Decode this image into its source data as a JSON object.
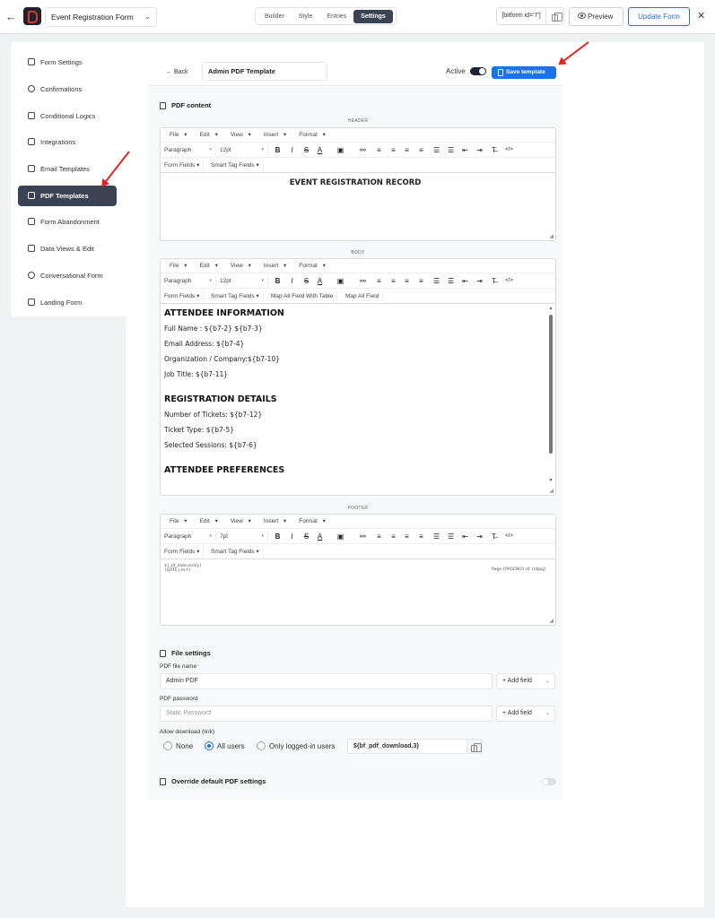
{
  "topbar": {
    "form_name": "Event Registration Form",
    "tabs": [
      {
        "label": "Builder",
        "active": false
      },
      {
        "label": "Style",
        "active": false
      },
      {
        "label": "Entries",
        "active": false
      },
      {
        "label": "Settings",
        "active": true
      }
    ],
    "shortcode": "[bitform id='7']",
    "preview_label": "Preview",
    "update_label": "Update Form",
    "close_glyph": "✕",
    "back_glyph": "←"
  },
  "sidebar": {
    "items": [
      {
        "label": "Form Settings",
        "icon": "sliders-icon",
        "active": false
      },
      {
        "label": "Confirmations",
        "icon": "info-icon",
        "active": false
      },
      {
        "label": "Conditional Logics",
        "icon": "logic-icon",
        "active": false
      },
      {
        "label": "Integrations",
        "icon": "code-icon",
        "active": false
      },
      {
        "label": "Email Templates",
        "icon": "mail-icon",
        "active": false
      },
      {
        "label": "PDF Templates",
        "icon": "document-icon",
        "active": true
      },
      {
        "label": "Form Abandonment",
        "icon": "edit-icon",
        "active": false
      },
      {
        "label": "Data Views & Edit",
        "icon": "table-icon",
        "active": false
      },
      {
        "label": "Conversational Form",
        "icon": "chat-icon",
        "active": false
      },
      {
        "label": "Landing Form",
        "icon": "page-icon",
        "active": false
      }
    ]
  },
  "template": {
    "back_label": "Back",
    "title": "Admin PDF Template",
    "active_label": "Active",
    "save_label": "Save template",
    "pdf_content_label": "PDF content"
  },
  "editor": {
    "menus": [
      "File",
      "Edit",
      "View",
      "Insert",
      "Format"
    ],
    "block_format": "Paragraph",
    "field_buttons": [
      "Form Fields",
      "Smart Tag Fields"
    ],
    "body_extra_buttons": [
      "Map All Field With Table",
      "Map All Field"
    ]
  },
  "header": {
    "caption": "HEADER",
    "font_size": "12pt",
    "content": "EVENT REGISTRATION RECORD"
  },
  "body": {
    "caption": "BODY",
    "font_size": "12pt",
    "sections": [
      {
        "heading": "ATTENDEE INFORMATION",
        "lines": [
          "Full Name : ${b7-2} ${b7-3}",
          "Email Address: ${b7-4}",
          "Organization / Company:${b7-10}",
          "Job Title: ${b7-11}"
        ]
      },
      {
        "heading": "REGISTRATION DETAILS",
        "lines": [
          "Number of Tickets: ${b7-12}",
          "Ticket Type: ${b7-5}",
          "Selected Sessions: ${b7-6}"
        ]
      },
      {
        "heading": "ATTENDEE PREFERENCES",
        "lines": []
      }
    ]
  },
  "footer": {
    "caption": "FOOTER",
    "font_size": "7pt",
    "left_line1": "${_bf_date.m/d/y}",
    "left_line2": "{DATE j-m-Y}",
    "right": "Page {PAGENO} of {nbpg}"
  },
  "file_settings": {
    "title": "File settings",
    "file_name_label": "PDF file name",
    "file_name_value": "Admin PDF",
    "password_label": "PDF password",
    "password_placeholder": "Static Password",
    "add_field_label": "+ Add field",
    "allow_download_label": "Allow download (link)",
    "download_options": [
      {
        "label": "None",
        "selected": false
      },
      {
        "label": "All users",
        "selected": true
      },
      {
        "label": "Only logged-in users",
        "selected": false
      }
    ],
    "download_shortcode": "${bf_pdf_download.3}"
  },
  "override": {
    "label": "Override default PDF settings",
    "enabled": false
  },
  "colors": {
    "accent": "#1a73e8",
    "dark": "#3b4254",
    "annotation_arrow": "#e8231f"
  }
}
